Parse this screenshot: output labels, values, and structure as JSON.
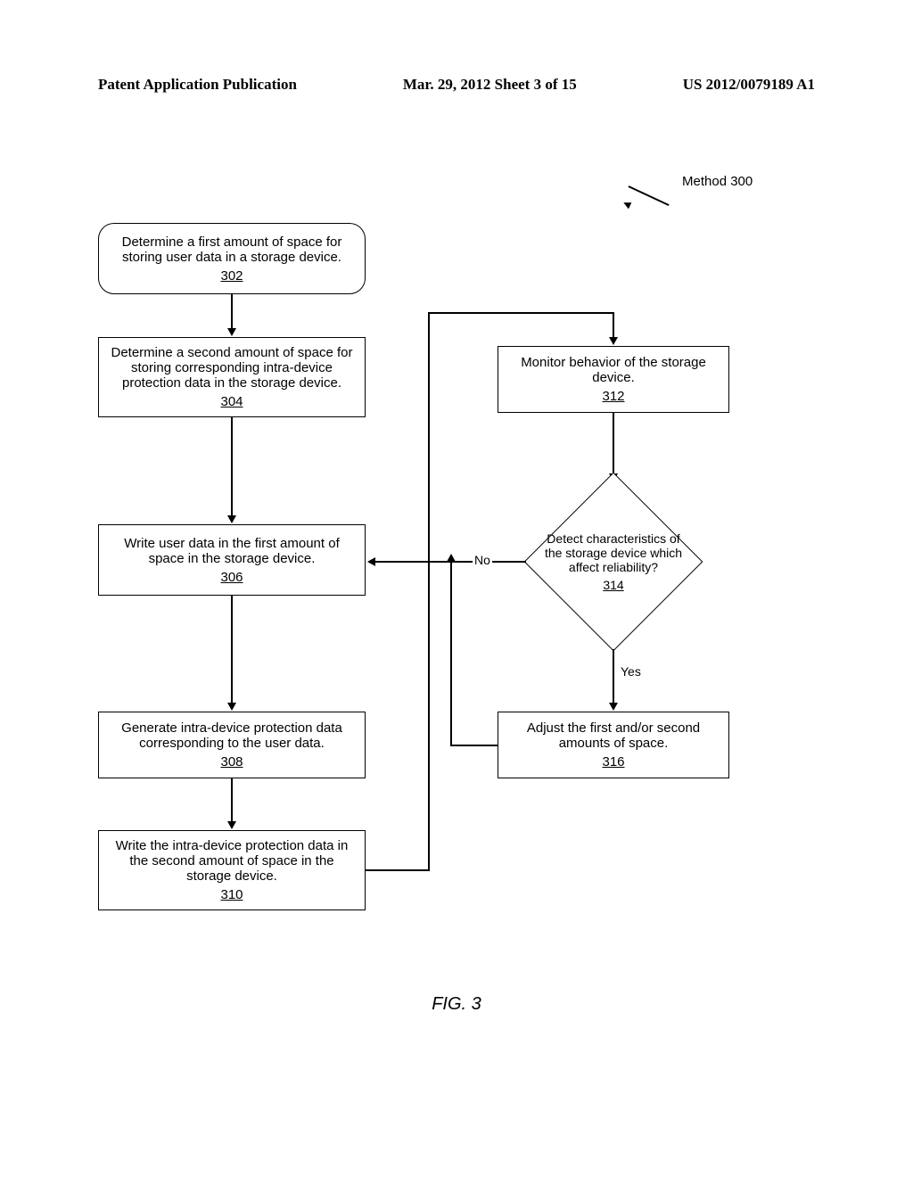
{
  "header": {
    "left": "Patent Application Publication",
    "center": "Mar. 29, 2012  Sheet 3 of 15",
    "right": "US 2012/0079189 A1"
  },
  "method_label": "Method 300",
  "boxes": {
    "b302": {
      "text": "Determine a first amount of space for storing user data in a storage device.",
      "ref": "302"
    },
    "b304": {
      "text": "Determine a second amount of space for storing corresponding intra-device protection data in the storage device.",
      "ref": "304"
    },
    "b306": {
      "text": "Write user data in the first amount of space in the storage device.",
      "ref": "306"
    },
    "b308": {
      "text": "Generate intra-device protection data corresponding to the user data.",
      "ref": "308"
    },
    "b310": {
      "text": "Write the intra-device protection data in the second amount of space in the storage device.",
      "ref": "310"
    },
    "b312": {
      "text": "Monitor behavior of the storage device.",
      "ref": "312"
    },
    "b314": {
      "text": "Detect characteristics of the storage device which affect reliability?",
      "ref": "314"
    },
    "b316": {
      "text": "Adjust the first and/or second amounts of space.",
      "ref": "316"
    }
  },
  "edges": {
    "no": "No",
    "yes": "Yes"
  },
  "figure_label": "FIG. 3"
}
